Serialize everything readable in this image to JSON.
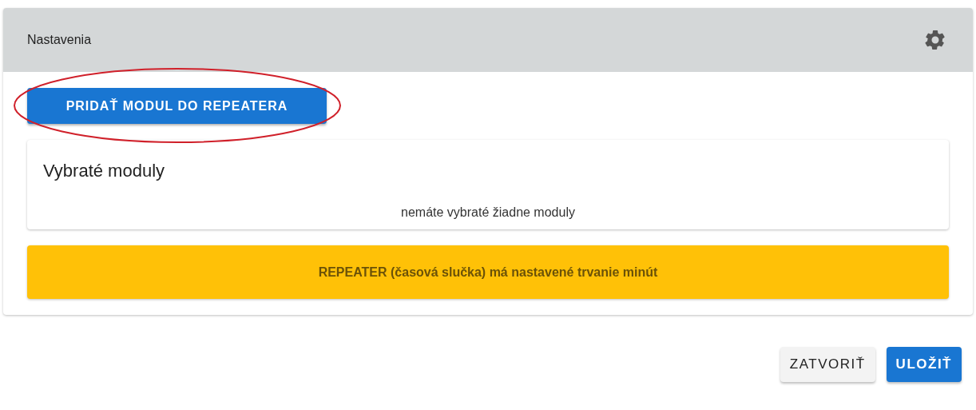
{
  "panel": {
    "title": "Nastavenia"
  },
  "add_button": {
    "label": "PRIDAŤ MODUL DO REPEATERA",
    "highlighted": true
  },
  "modules": {
    "title": "Vybraté moduly",
    "empty_text": "nemáte vybraté žiadne moduly"
  },
  "warning": {
    "text": "REPEATER (časová slučka) má nastavené trvanie minút"
  },
  "actions": [
    {
      "kind": "secondary",
      "label": "ZATVORIŤ"
    },
    {
      "kind": "primary",
      "label": "ULOŽIŤ"
    }
  ]
}
